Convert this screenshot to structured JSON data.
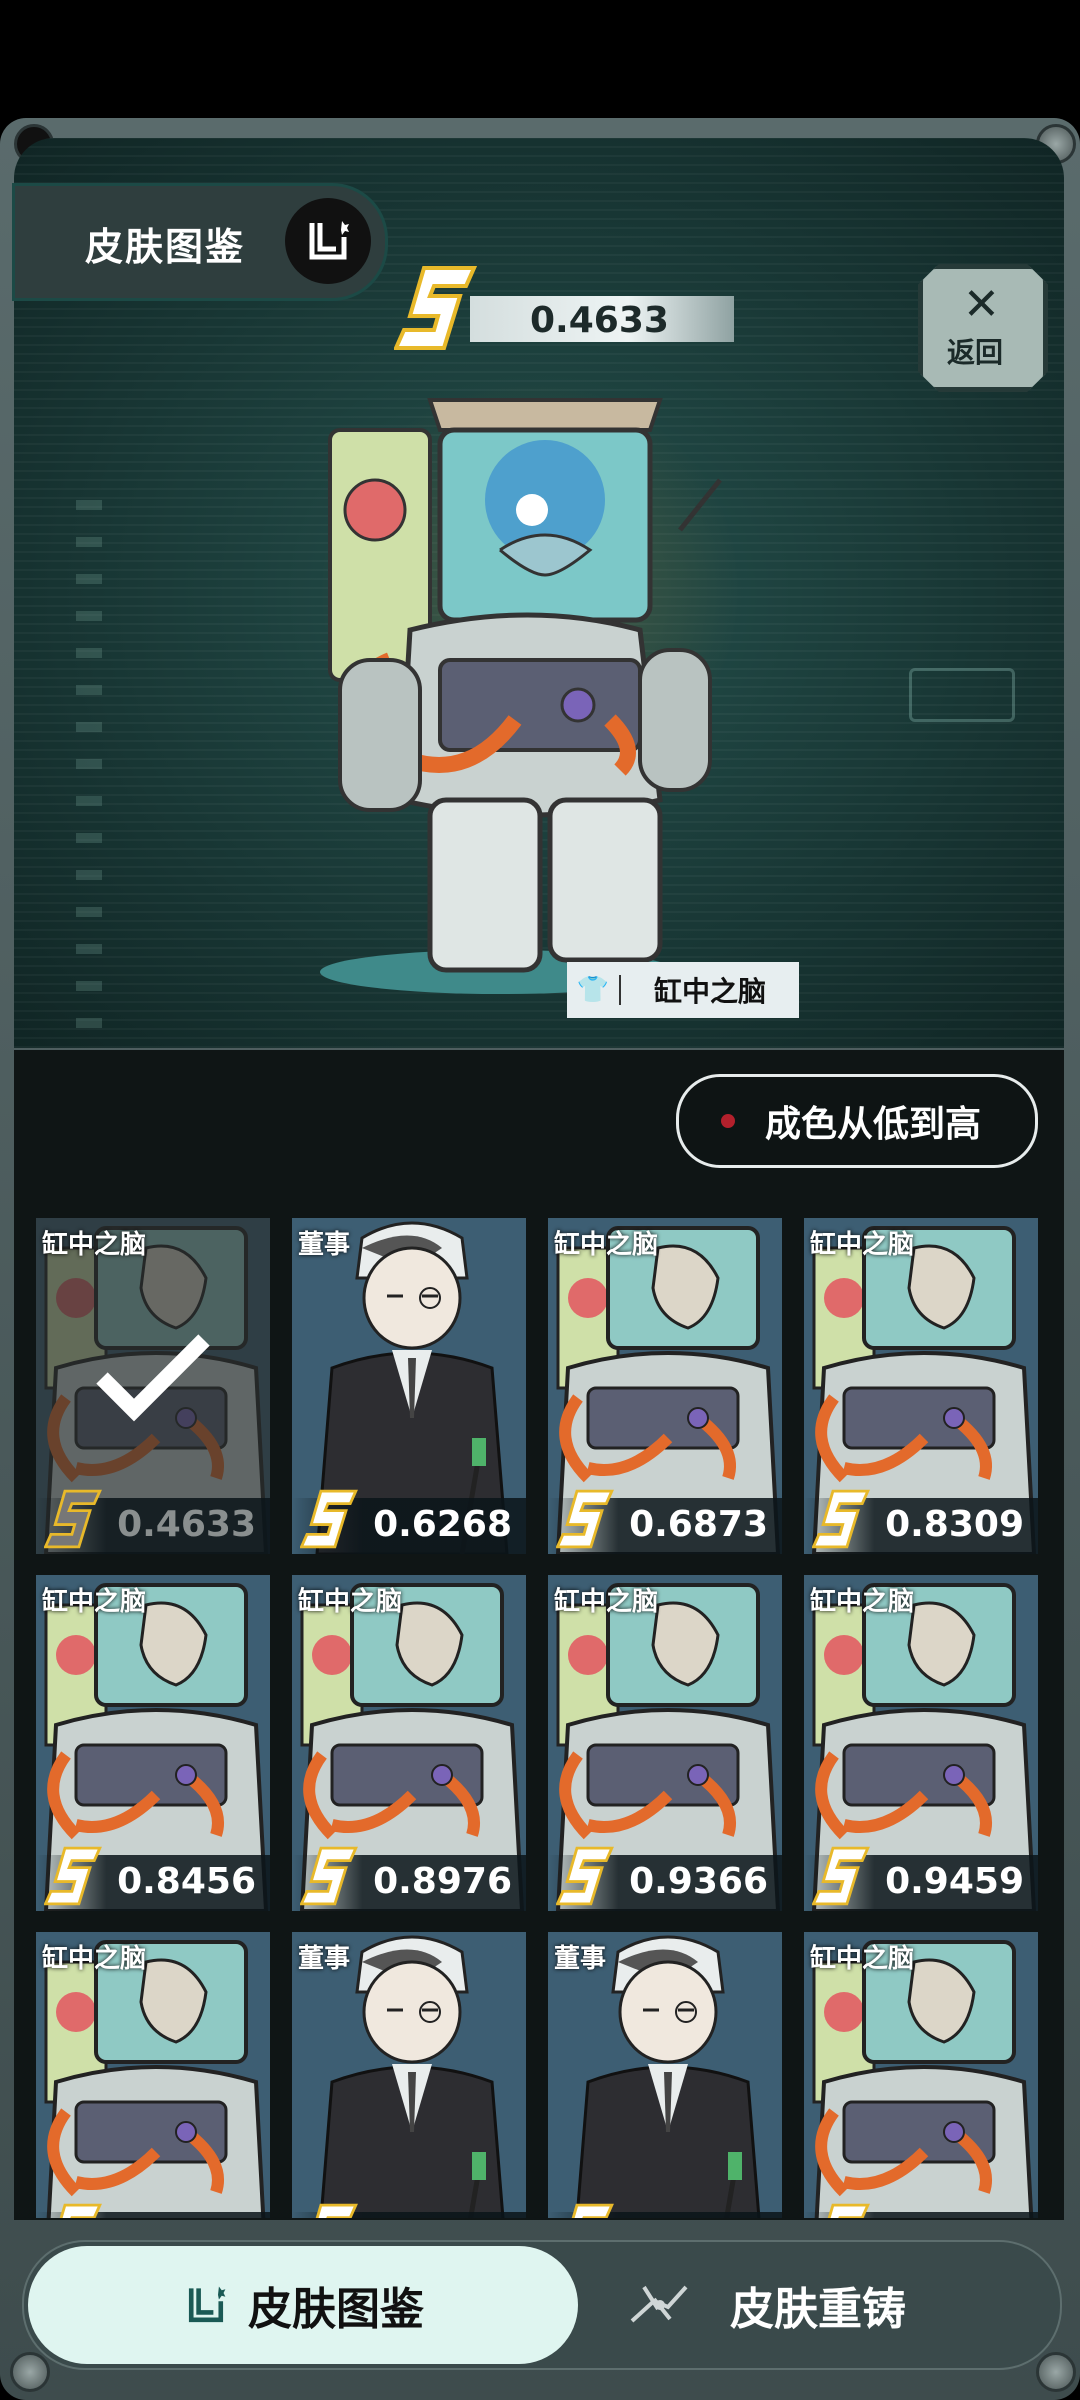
{
  "header": {
    "title": "皮肤图鉴",
    "score": "0.4633",
    "close_label": "返回"
  },
  "preview": {
    "skin_name": "缸中之脑"
  },
  "sort": {
    "label": "成色从低到高"
  },
  "skins": [
    {
      "name": "缸中之脑",
      "value": "0.4633",
      "selected": true,
      "type": "brain"
    },
    {
      "name": "董事",
      "value": "0.6268",
      "selected": false,
      "type": "director"
    },
    {
      "name": "缸中之脑",
      "value": "0.6873",
      "selected": false,
      "type": "brain"
    },
    {
      "name": "缸中之脑",
      "value": "0.8309",
      "selected": false,
      "type": "brain"
    },
    {
      "name": "缸中之脑",
      "value": "0.8456",
      "selected": false,
      "type": "brain"
    },
    {
      "name": "缸中之脑",
      "value": "0.8976",
      "selected": false,
      "type": "brain"
    },
    {
      "name": "缸中之脑",
      "value": "0.9366",
      "selected": false,
      "type": "brain"
    },
    {
      "name": "缸中之脑",
      "value": "0.9459",
      "selected": false,
      "type": "brain"
    },
    {
      "name": "缸中之脑",
      "value": "",
      "selected": false,
      "type": "brain"
    },
    {
      "name": "董事",
      "value": "",
      "selected": false,
      "type": "director"
    },
    {
      "name": "董事",
      "value": "",
      "selected": false,
      "type": "director"
    },
    {
      "name": "缸中之脑",
      "value": "",
      "selected": false,
      "type": "brain"
    }
  ],
  "bottom_tabs": {
    "active_label": "皮肤图鉴",
    "inactive_label": "皮肤重铸"
  },
  "colors": {
    "accent_gold": "#f2c230",
    "panel_teal": "#16302f",
    "sort_dot": "#b3202c"
  }
}
